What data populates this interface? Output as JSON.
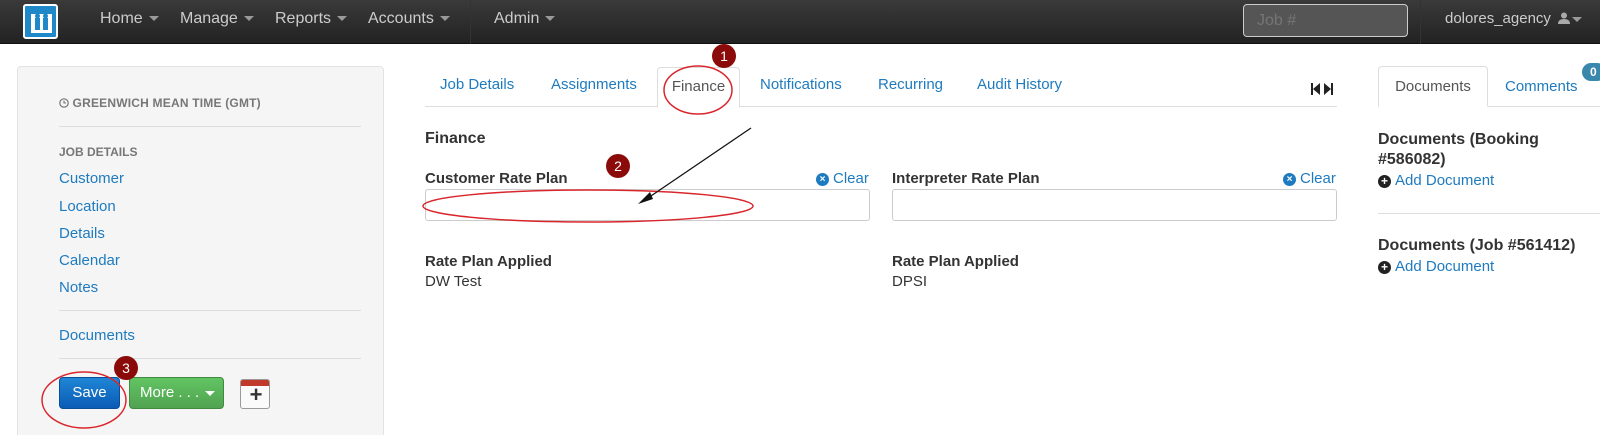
{
  "navbar": {
    "items": [
      {
        "label": "Home"
      },
      {
        "label": "Manage"
      },
      {
        "label": "Reports"
      },
      {
        "label": "Accounts"
      },
      {
        "label": "Admin"
      }
    ],
    "job_search_placeholder": "Job #",
    "user": "dolores_agency"
  },
  "sidebar": {
    "timezone": "GREENWICH MEAN TIME (GMT)",
    "section_heading": "JOB DETAILS",
    "links": [
      {
        "label": "Customer"
      },
      {
        "label": "Location"
      },
      {
        "label": "Details"
      },
      {
        "label": "Calendar"
      },
      {
        "label": "Notes"
      }
    ],
    "documents_link": "Documents",
    "save_label": "Save",
    "more_label": "More . . .",
    "calendar_icon": "calendar-add-icon"
  },
  "main": {
    "tabs": [
      {
        "label": "Job Details"
      },
      {
        "label": "Assignments"
      },
      {
        "label": "Finance",
        "active": true
      },
      {
        "label": "Notifications"
      },
      {
        "label": "Recurring"
      },
      {
        "label": "Audit History"
      }
    ],
    "section_title": "Finance",
    "customer_rate_plan": {
      "label": "Customer Rate Plan",
      "clear": "Clear",
      "value": "",
      "applied_label": "Rate Plan Applied",
      "applied_value": "DW Test"
    },
    "interpreter_rate_plan": {
      "label": "Interpreter Rate Plan",
      "clear": "Clear",
      "value": "",
      "applied_label": "Rate Plan Applied",
      "applied_value": "DPSI"
    }
  },
  "right_panel": {
    "tabs": [
      {
        "label": "Documents",
        "active": true
      },
      {
        "label": "Comments",
        "badge": "0"
      }
    ],
    "booking_docs_title": "Documents (Booking #586082)",
    "job_docs_title": "Documents (Job #561412)",
    "add_document": "Add Document"
  },
  "annotations": {
    "markers": [
      "1",
      "2",
      "3"
    ],
    "accent_color": "#8b0a0a",
    "highlight_color": "#d9262c"
  },
  "colors": {
    "link": "#1e7bbf",
    "navbar": "#222222",
    "save_button": "#0b5bb5",
    "more_button": "#51a351"
  }
}
